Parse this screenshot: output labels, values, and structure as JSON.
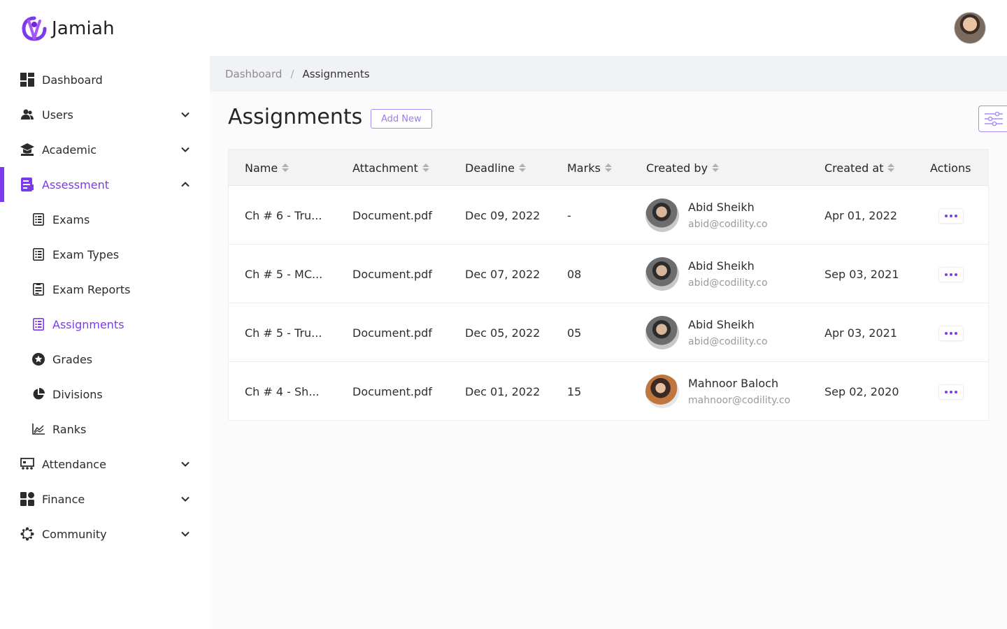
{
  "app": {
    "name": "Jamiah"
  },
  "colors": {
    "accent": "#7c3aed",
    "breadcrumb_bg": "#f0f2f5"
  },
  "sidebar": {
    "items": [
      {
        "label": "Dashboard",
        "icon": "dashboard-icon"
      },
      {
        "label": "Users",
        "icon": "users-icon",
        "expandable": true
      },
      {
        "label": "Academic",
        "icon": "academic-cap-icon",
        "expandable": true
      },
      {
        "label": "Assessment",
        "icon": "clipboard-icon",
        "expandable": true,
        "expanded": true,
        "active": true,
        "children": [
          {
            "label": "Exams",
            "icon": "list-icon"
          },
          {
            "label": "Exam Types",
            "icon": "list-icon"
          },
          {
            "label": "Exam Reports",
            "icon": "report-icon"
          },
          {
            "label": "Assignments",
            "icon": "list-icon",
            "active": true
          },
          {
            "label": "Grades",
            "icon": "star-circle-icon"
          },
          {
            "label": "Divisions",
            "icon": "pie-chart-icon"
          },
          {
            "label": "Ranks",
            "icon": "line-chart-icon"
          }
        ]
      },
      {
        "label": "Attendance",
        "icon": "attendance-icon",
        "expandable": true
      },
      {
        "label": "Finance",
        "icon": "finance-grid-icon",
        "expandable": true
      },
      {
        "label": "Community",
        "icon": "community-icon",
        "expandable": true
      }
    ]
  },
  "breadcrumb": {
    "parent": "Dashboard",
    "separator": "/",
    "current": "Assignments"
  },
  "page": {
    "title": "Assignments",
    "add_label": "Add New"
  },
  "table": {
    "columns": [
      "Name",
      "Attachment",
      "Deadline",
      "Marks",
      "Created by",
      "Created at",
      "Actions"
    ],
    "rows": [
      {
        "name": "Ch # 6 - Tru...",
        "attachment": "Document.pdf",
        "deadline": "Dec 09, 2022",
        "marks": "-",
        "creator_name": "Abid Sheikh",
        "creator_email": "abid@codility.co",
        "created_at": "Apr 01, 2022"
      },
      {
        "name": "Ch # 5 - MC...",
        "attachment": "Document.pdf",
        "deadline": "Dec 07, 2022",
        "marks": "08",
        "creator_name": "Abid Sheikh",
        "creator_email": "abid@codility.co",
        "created_at": "Sep 03, 2021"
      },
      {
        "name": "Ch # 5 - Tru...",
        "attachment": "Document.pdf",
        "deadline": "Dec 05, 2022",
        "marks": "05",
        "creator_name": "Abid Sheikh",
        "creator_email": "abid@codility.co",
        "created_at": "Apr 03, 2021"
      },
      {
        "name": "Ch # 4 - Sh...",
        "attachment": "Document.pdf",
        "deadline": "Dec 01, 2022",
        "marks": "15",
        "creator_name": "Mahnoor Baloch",
        "creator_email": "mahnoor@codility.co",
        "created_at": "Sep 02, 2020"
      }
    ]
  }
}
